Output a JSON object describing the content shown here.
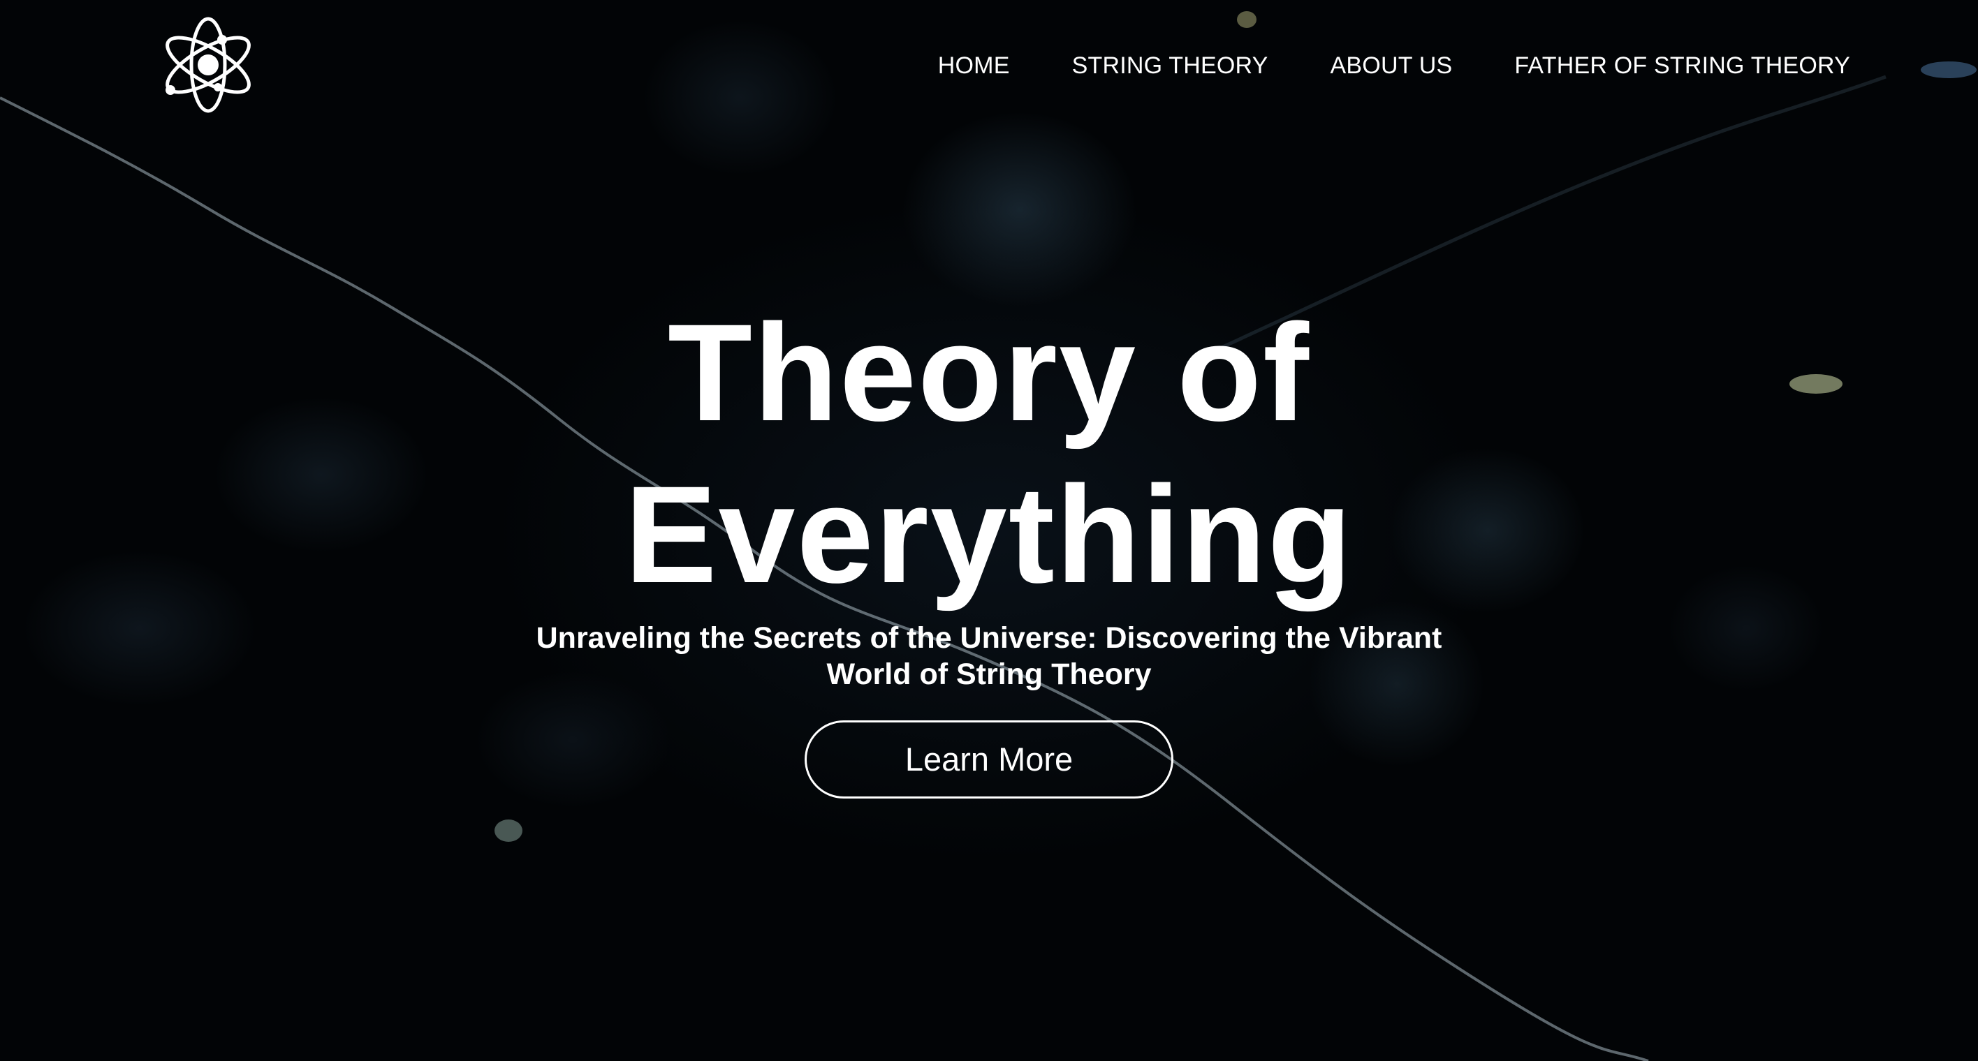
{
  "header": {
    "logo_icon": "atom-icon",
    "nav": [
      {
        "label": "HOME"
      },
      {
        "label": "STRING THEORY"
      },
      {
        "label": "ABOUT US"
      },
      {
        "label": "FATHER OF STRING THEORY"
      }
    ]
  },
  "hero": {
    "title_line1": "Theory of",
    "title_line2": "Everything",
    "subtitle": "Unraveling the Secrets of the Universe: Discovering the Vibrant World of String Theory",
    "cta_label": "Learn More"
  },
  "colors": {
    "background": "#020406",
    "text": "#ffffff"
  }
}
